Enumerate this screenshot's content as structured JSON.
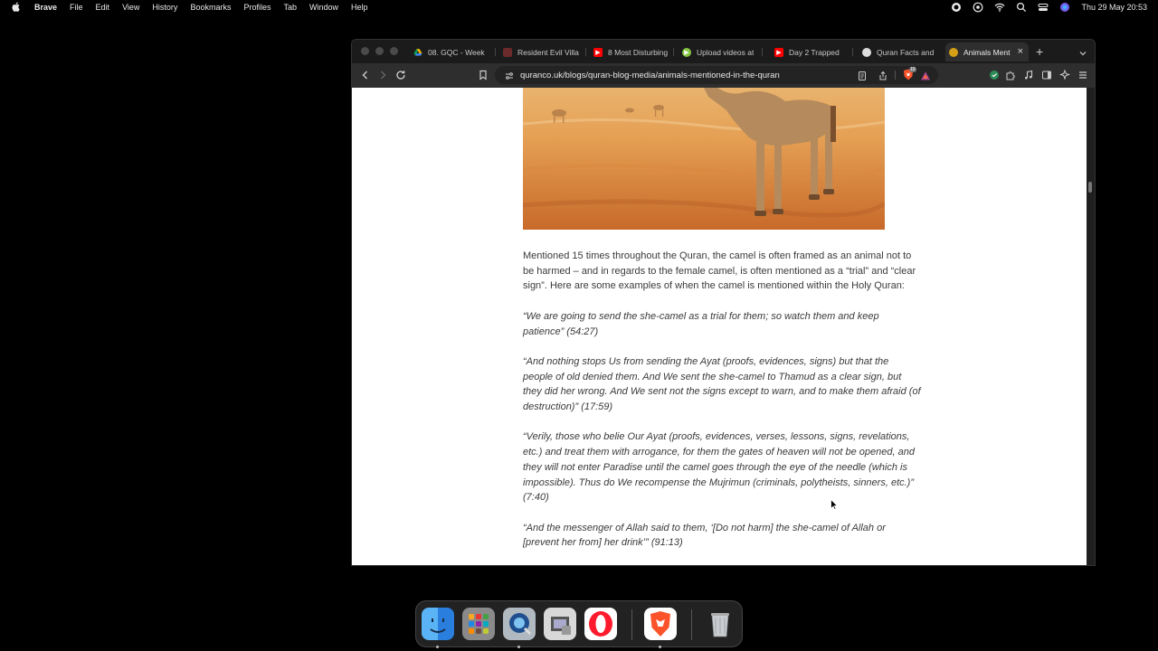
{
  "menubar": {
    "app": "Brave",
    "items": [
      "File",
      "Edit",
      "View",
      "History",
      "Bookmarks",
      "Profiles",
      "Tab",
      "Window",
      "Help"
    ],
    "clock": "Thu 29 May  20:53"
  },
  "browser": {
    "tabs": [
      {
        "label": "08. GQC - Week",
        "favicon": "drive-icon",
        "color": "#f4b400"
      },
      {
        "label": "Resident Evil Villa",
        "favicon": "game-icon",
        "color": "#c0392b"
      },
      {
        "label": "8 Most Disturbing",
        "favicon": "youtube-icon",
        "color": "#ff0000"
      },
      {
        "label": "Upload videos at",
        "favicon": "rumble-icon",
        "color": "#85c742"
      },
      {
        "label": "Day 2 Trapped",
        "favicon": "youtube-icon",
        "color": "#ff0000"
      },
      {
        "label": "Quran Facts and",
        "favicon": "globe-icon",
        "color": "#888888"
      },
      {
        "label": "Animals Menti",
        "favicon": "quran-icon",
        "color": "#d4a017"
      }
    ],
    "url": "quranco.uk/blogs/quran-blog-media/animals-mentioned-in-the-quran",
    "shield_count": "10"
  },
  "article": {
    "intro": "Mentioned 15 times throughout the Quran, the camel is often framed as an animal not to be harmed – and in regards to the female camel, is often mentioned as a “trial” and “clear sign”. Here are some examples of when the camel is mentioned within the Holy Quran:",
    "quotes": [
      "“We are going to send the she-camel as a trial for them; so watch them and keep patience” (54:27)",
      "“And nothing stops Us from sending the Ayat (proofs, evidences, signs) but that the people of old denied them. And We sent the she-camel to Thamud as a clear sign, but they did her wrong. And We sent not the signs except to warn, and to make them afraid (of destruction)” (17:59)",
      "“Verily, those who belie Our Ayat (proofs, evidences, verses, lessons, signs, revelations, etc.) and treat them with arrogance, for them the gates of heaven will not be opened, and they will not enter Paradise until the camel goes through the eye of the needle (which is impossible). Thus do We recompense the Mujrimun (criminals, polytheists, sinners, etc.)” (7:40)",
      "“And the messenger of Allah said to them, ‘[Do not harm] the she-camel of Allah or [prevent her from] her drink’” (91:13)"
    ]
  },
  "dock": {
    "apps": [
      "finder",
      "launchpad",
      "quicktime",
      "preview",
      "opera",
      "brave",
      "trash"
    ]
  },
  "colors": {
    "page_bg": "#ffffff",
    "text": "#3a3a3a",
    "chrome": "#2e2e2e"
  }
}
